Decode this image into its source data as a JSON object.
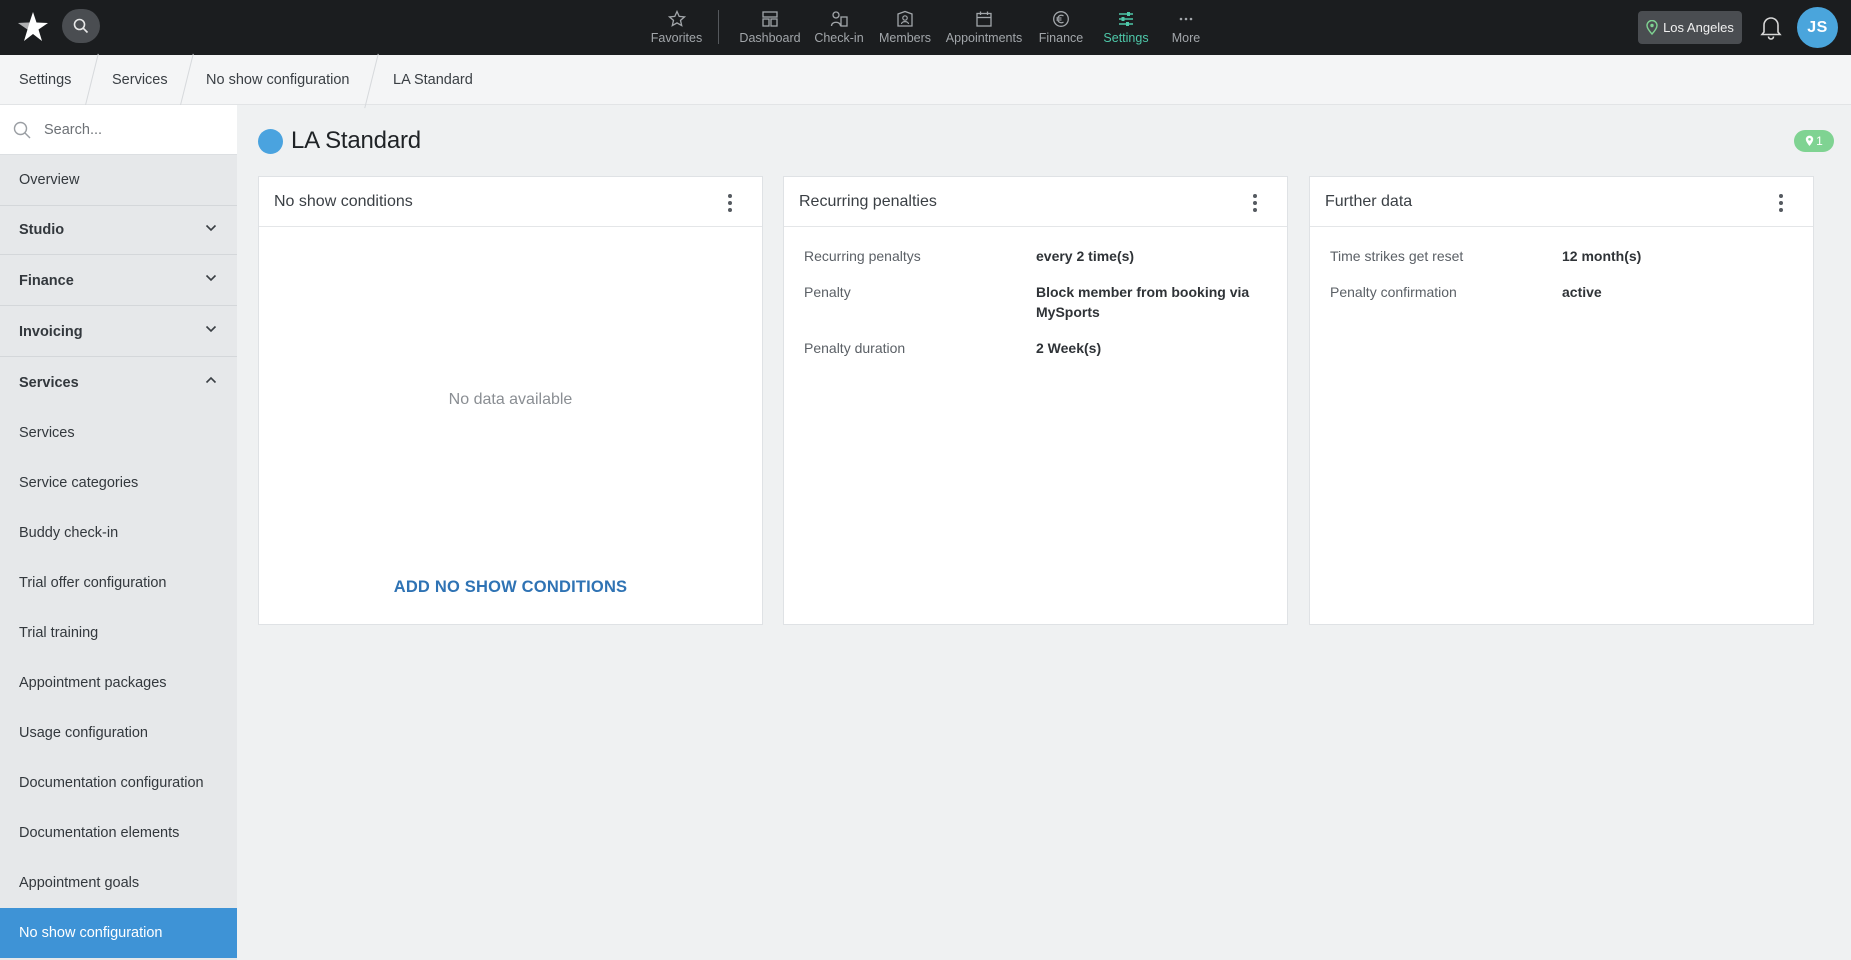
{
  "colors": {
    "accent": "#4ec8a9",
    "primary": "#3e93d6",
    "topbar": "#1b1d1f",
    "badge": "#7fd392"
  },
  "topnav": {
    "items": [
      {
        "label": "Favorites",
        "icon": "star-icon"
      },
      {
        "label": "Dashboard",
        "icon": "dashboard-icon"
      },
      {
        "label": "Check-in",
        "icon": "check-in-icon"
      },
      {
        "label": "Members",
        "icon": "members-icon"
      },
      {
        "label": "Appointments",
        "icon": "calendar-icon"
      },
      {
        "label": "Finance",
        "icon": "euro-icon"
      },
      {
        "label": "Settings",
        "icon": "sliders-icon",
        "active": true
      },
      {
        "label": "More",
        "icon": "more-icon"
      }
    ],
    "location": "Los Angeles",
    "avatar_initials": "JS"
  },
  "breadcrumb": [
    "Settings",
    "Services",
    "No show configuration",
    "LA Standard"
  ],
  "sidebar": {
    "search_placeholder": "Search...",
    "items": [
      {
        "label": "Overview",
        "type": "item"
      },
      {
        "label": "Studio",
        "type": "group",
        "expanded": false
      },
      {
        "label": "Finance",
        "type": "group",
        "expanded": false
      },
      {
        "label": "Invoicing",
        "type": "group",
        "expanded": false
      },
      {
        "label": "Services",
        "type": "group",
        "expanded": true
      },
      {
        "label": "Services",
        "type": "item"
      },
      {
        "label": "Service categories",
        "type": "item"
      },
      {
        "label": "Buddy check-in",
        "type": "item"
      },
      {
        "label": "Trial offer configuration",
        "type": "item"
      },
      {
        "label": "Trial training",
        "type": "item"
      },
      {
        "label": "Appointment packages",
        "type": "item"
      },
      {
        "label": "Usage configuration",
        "type": "item"
      },
      {
        "label": "Documentation configuration",
        "type": "item"
      },
      {
        "label": "Documentation elements",
        "type": "item"
      },
      {
        "label": "Appointment goals",
        "type": "item"
      },
      {
        "label": "No show configuration",
        "type": "item",
        "active": true
      }
    ]
  },
  "main": {
    "title": "LA Standard",
    "location_count": "1",
    "cards": {
      "conditions": {
        "title": "No show conditions",
        "empty_text": "No data available",
        "add_label": "ADD NO SHOW CONDITIONS"
      },
      "penalties": {
        "title": "Recurring penalties",
        "rows": [
          {
            "label": "Recurring penaltys",
            "value": "every 2 time(s)"
          },
          {
            "label": "Penalty",
            "value": "Block member from booking via MySports"
          },
          {
            "label": "Penalty duration",
            "value": "2 Week(s)"
          }
        ]
      },
      "further": {
        "title": "Further data",
        "rows": [
          {
            "label": "Time strikes get reset",
            "value": "12 month(s)"
          },
          {
            "label": "Penalty confirmation",
            "value": "active"
          }
        ]
      }
    }
  }
}
